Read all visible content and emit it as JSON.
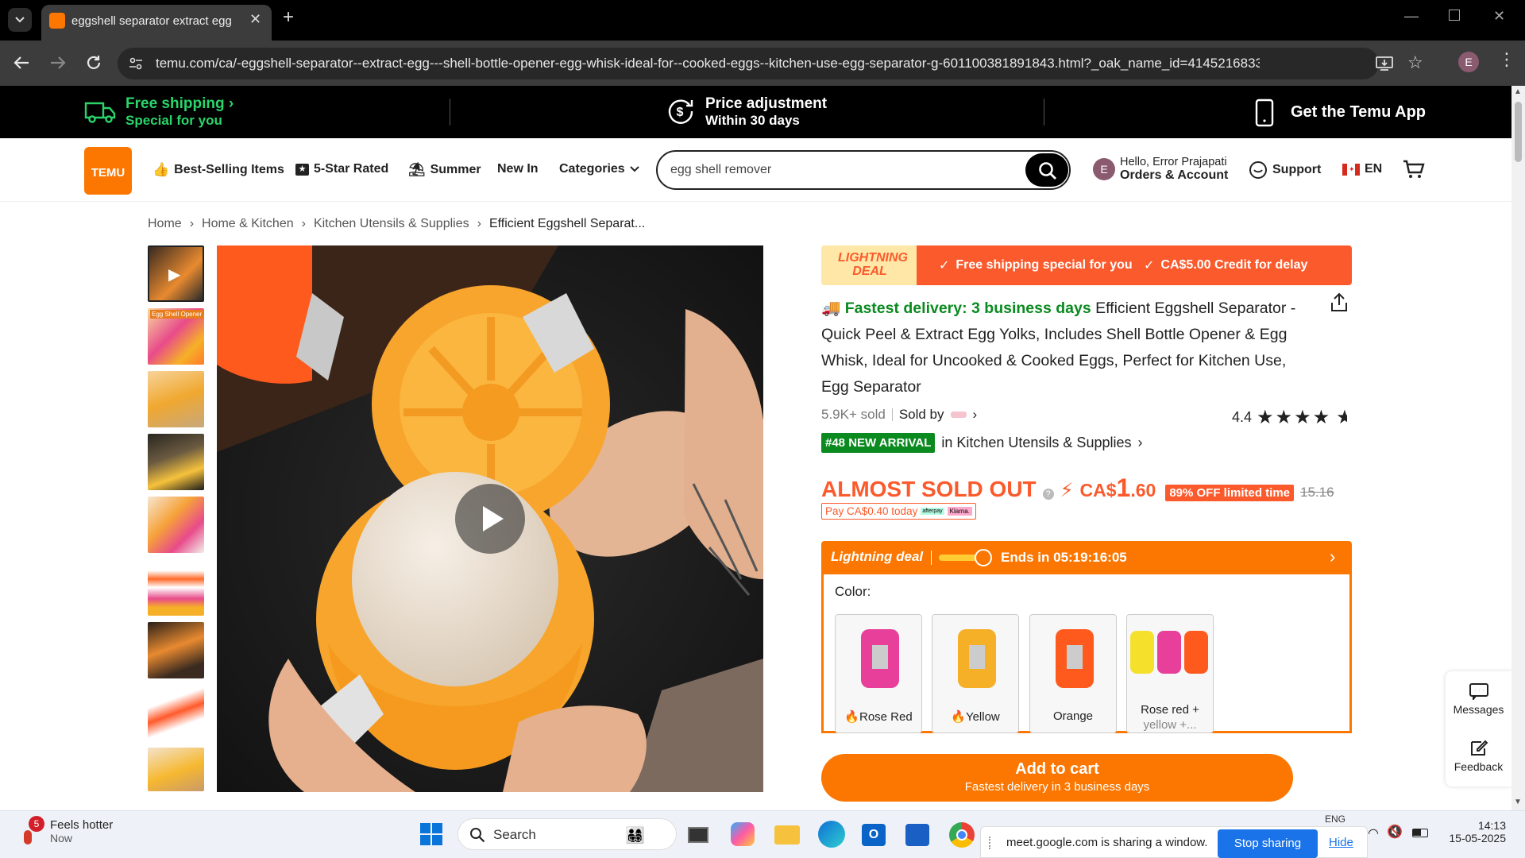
{
  "browser": {
    "tab_title": "eggshell separator extract egg",
    "url": "temu.com/ca/-eggshell-separator--extract-egg---shell-bottle-opener-egg-whisk-ideal-for--cooked-eggs--kitchen-use-egg-separator-g-601100381891843.html?_oak_name_id=414521683339927...",
    "profile_initial": "E"
  },
  "banner": {
    "free_shipping_title": "Free shipping",
    "free_shipping_sub": "Special for you",
    "price_adj_title": "Price adjustment",
    "price_adj_sub": "Within 30 days",
    "app_label": "Get the Temu App"
  },
  "header": {
    "logo_text": "TEMU",
    "nav": [
      "Best-Selling Items",
      "5-Star Rated",
      "Summer",
      "New In",
      "Categories"
    ],
    "search_value": "egg shell remover",
    "account_greeting": "Hello, Error Prajapati",
    "account_label": "Orders & Account",
    "account_initial": "E",
    "support": "Support",
    "lang": "EN"
  },
  "breadcrumb": [
    "Home",
    "Home & Kitchen",
    "Kitchen Utensils & Supplies",
    "Efficient Eggshell Separat..."
  ],
  "product": {
    "deal_badge": "LIGHTNING DEAL",
    "deal_points": [
      "Free shipping special for you",
      "CA$5.00 Credit for delay"
    ],
    "delivery_highlight": "Fastest delivery: 3 business days",
    "title": "Efficient Eggshell Separator - Quick Peel & Extract Egg Yolks, Includes Shell Bottle Opener & Egg Whisk, Ideal for Uncooked & Cooked Eggs, Perfect for Kitchen Use, Egg Separator",
    "sold": "5.9K+ sold",
    "sold_by": "Sold by",
    "rating": "4.4",
    "rank_badge": "#48 NEW ARRIVAL",
    "rank_category": "in Kitchen Utensils & Supplies",
    "stock_status": "ALMOST SOLD OUT",
    "price_currency": "CA$",
    "price_main": "1",
    "price_cents": ".60",
    "discount_badge": "89% OFF limited time",
    "original_price": "15.16",
    "pay_today": "Pay CA$0.40 today",
    "pay_logo_1": "afterpay",
    "pay_logo_2": "Klarna.",
    "lightning_label": "Lightning deal",
    "ends_in": "Ends in 05:19:16:05",
    "color_label": "Color:",
    "colors": [
      "Rose Red",
      "Yellow",
      "Orange",
      "Rose red +",
      "yellow +..."
    ],
    "add_to_cart": "Add to cart",
    "add_to_cart_sub": "Fastest delivery in 3 business days"
  },
  "side_widget": {
    "messages": "Messages",
    "feedback": "Feedback"
  },
  "taskbar": {
    "weather_title": "Feels hotter",
    "weather_sub": "Now",
    "weather_badge": "5",
    "search_placeholder": "Search",
    "lang": "ENG",
    "time": "14:13",
    "date": "15-05-2025",
    "share_text": "meet.google.com is sharing a window.",
    "stop_sharing": "Stop sharing",
    "hide": "Hide"
  },
  "colors": {
    "temu_orange": "#fb7701",
    "deal_red": "#fb5a2c",
    "green": "#0a8a1f"
  }
}
